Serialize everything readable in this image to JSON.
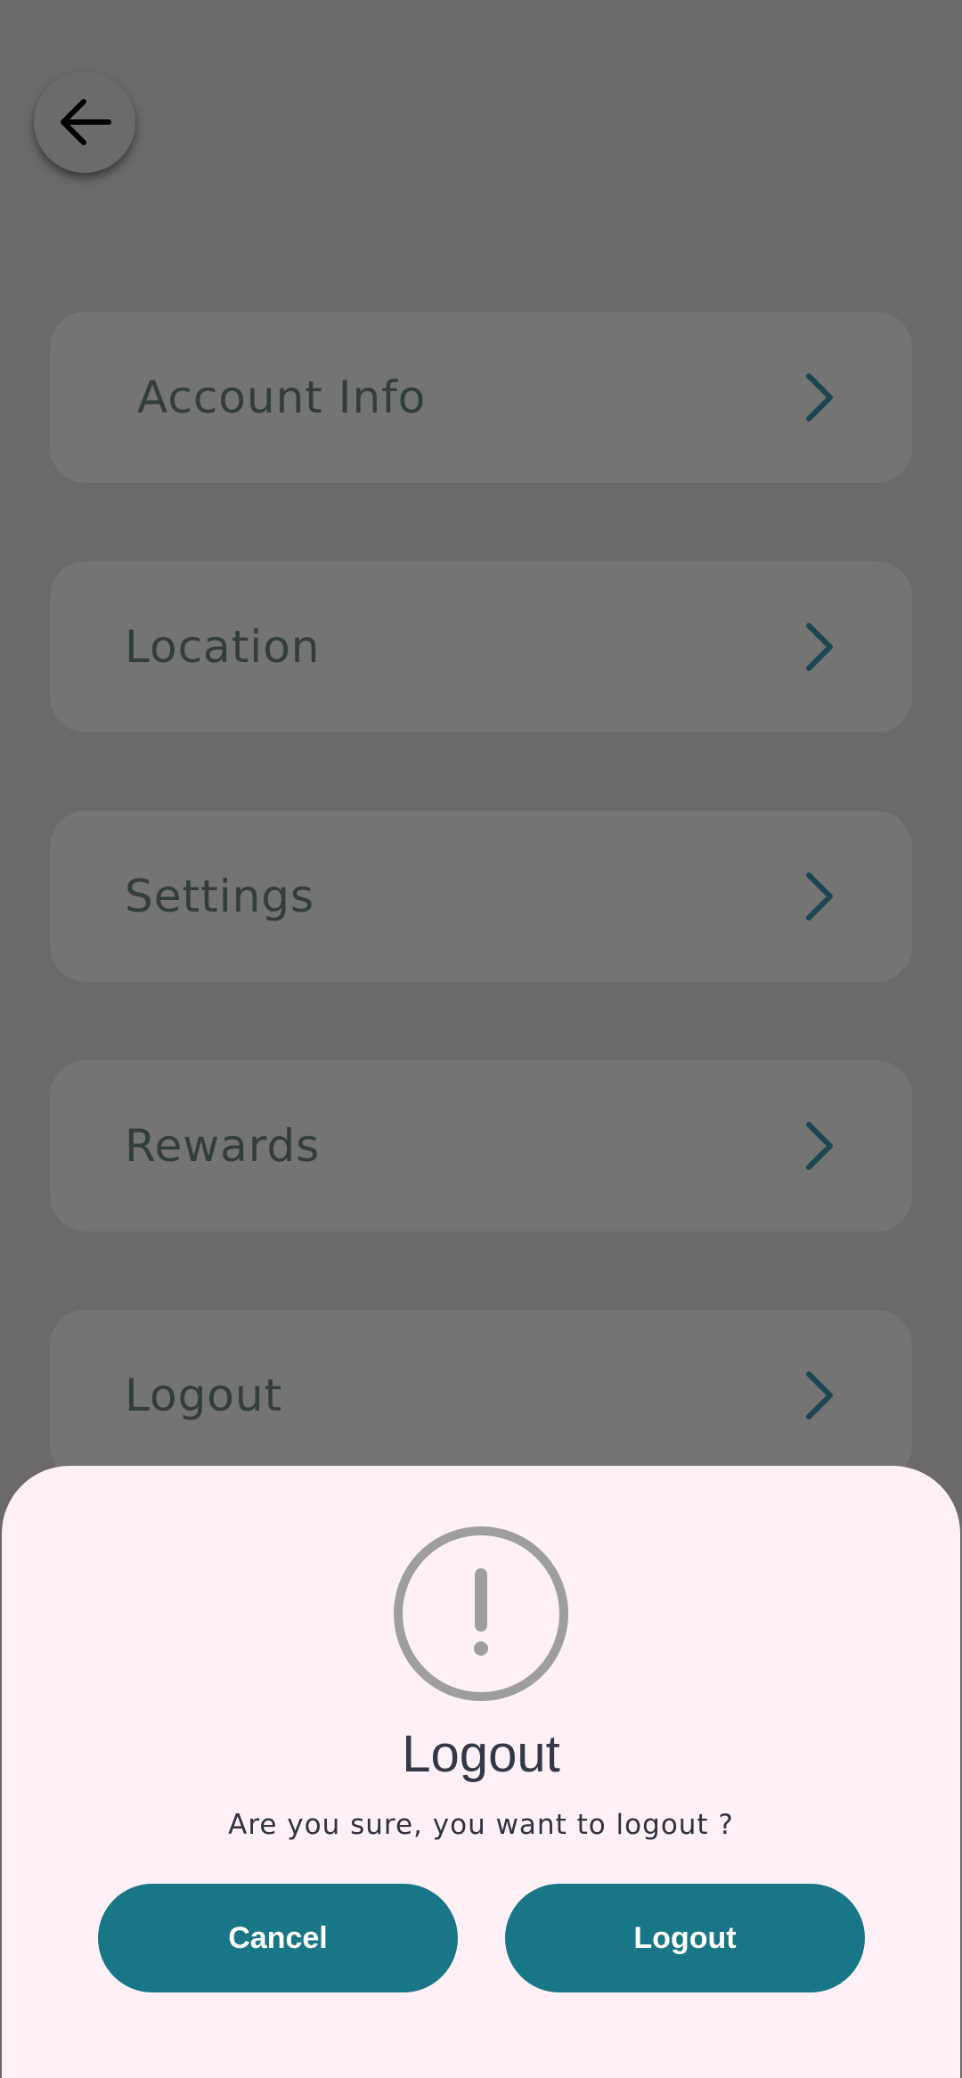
{
  "header": {
    "back_icon": "arrow-left-icon"
  },
  "menu": {
    "items": [
      {
        "label": "Account Info",
        "icon": "chevron-right-icon"
      },
      {
        "label": "Location",
        "icon": "chevron-right-icon"
      },
      {
        "label": "Settings",
        "icon": "chevron-right-icon"
      },
      {
        "label": "Rewards",
        "icon": "chevron-right-icon"
      },
      {
        "label": "Logout",
        "icon": "chevron-right-icon"
      }
    ]
  },
  "dialog": {
    "icon": "alert-circle-icon",
    "title": "Logout",
    "message": "Are you sure, you want to logout ?",
    "cancel_label": "Cancel",
    "confirm_label": "Logout"
  },
  "colors": {
    "overlay": "#6b6a68",
    "card": "#747474",
    "sheet": "#fdf1f7",
    "primary": "#187686",
    "chevron": "#1c4650",
    "alert_gray": "#9e9e9e"
  }
}
